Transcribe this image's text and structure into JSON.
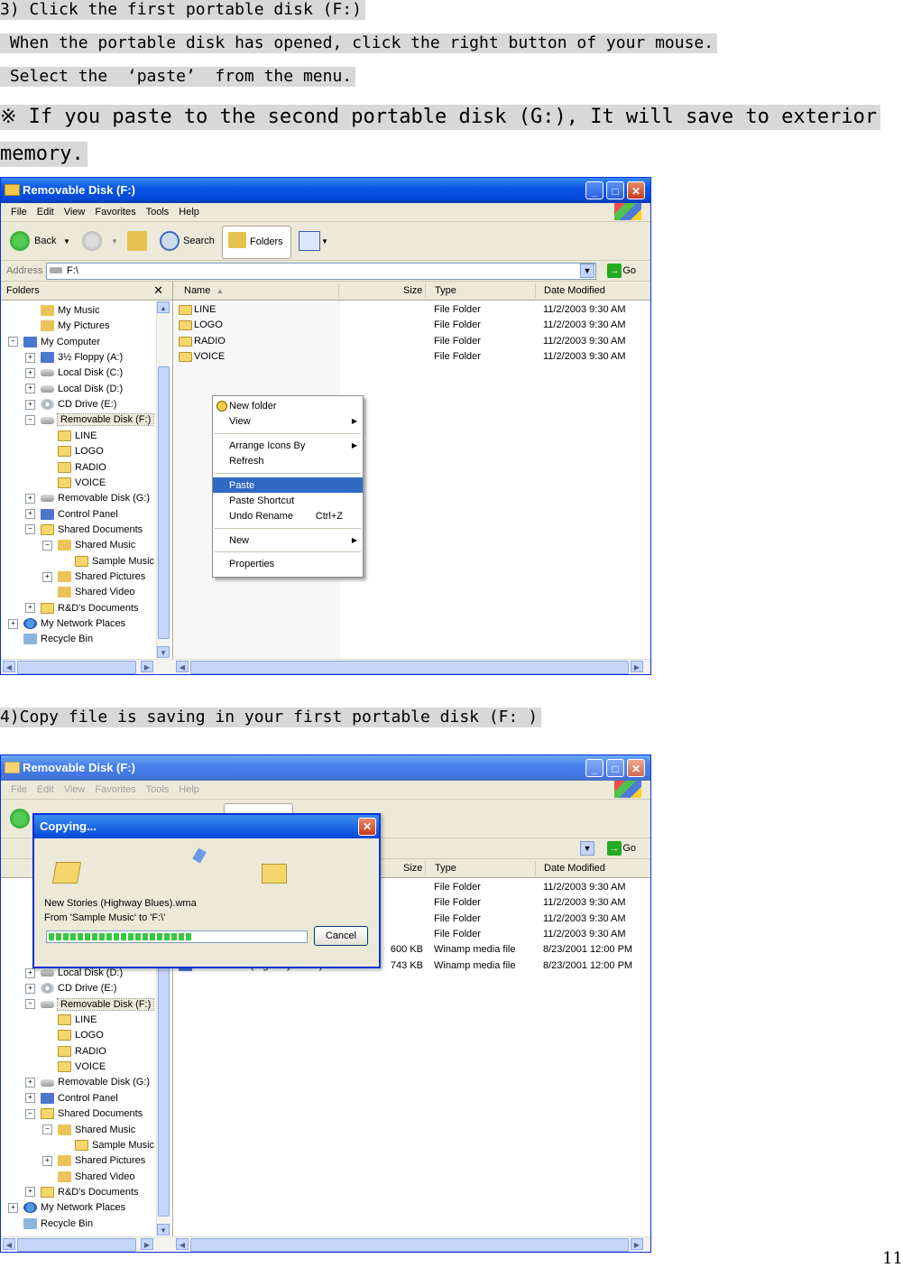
{
  "instructions": {
    "line1": "3) Click the first portable disk (F:)",
    "line2": " When the portable disk has opened, click the right button of your mouse.",
    "line3": " Select the  ‘paste’  from the menu.",
    "note_line1": "※ If you paste to the second portable disk (G:), It will save to exterior",
    "note_line2": "memory.",
    "step4": "4)Copy file is saving in your first portable disk (F: )"
  },
  "page_number": "11",
  "window": {
    "title": "Removable Disk (F:)",
    "menu": [
      "File",
      "Edit",
      "View",
      "Favorites",
      "Tools",
      "Help"
    ],
    "toolbar": {
      "back": "Back",
      "search": "Search",
      "folders": "Folders"
    },
    "address_label": "Address",
    "address_value": "F:\\",
    "go": "Go",
    "folders_header": "Folders",
    "columns": {
      "name": "Name",
      "size": "Size",
      "type": "Type",
      "date": "Date Modified"
    }
  },
  "tree1": [
    {
      "label": "My Music",
      "indent": 2,
      "icon": "music-folder-icon"
    },
    {
      "label": "My Pictures",
      "indent": 2,
      "icon": "pictures-folder-icon"
    },
    {
      "label": "My Computer",
      "indent": 1,
      "pm": "-",
      "icon": "computer-icon"
    },
    {
      "label": "3½ Floppy (A:)",
      "indent": 2,
      "pm": "+",
      "icon": "floppy-icon"
    },
    {
      "label": "Local Disk (C:)",
      "indent": 2,
      "pm": "+",
      "icon": "drive-icon"
    },
    {
      "label": "Local Disk (D:)",
      "indent": 2,
      "pm": "+",
      "icon": "drive-icon"
    },
    {
      "label": "CD Drive (E:)",
      "indent": 2,
      "pm": "+",
      "icon": "cd-icon"
    },
    {
      "label": "Removable Disk (F:)",
      "indent": 2,
      "pm": "-",
      "icon": "drive-icon",
      "sel": true
    },
    {
      "label": "LINE",
      "indent": 3,
      "icon": "folder-icon"
    },
    {
      "label": "LOGO",
      "indent": 3,
      "icon": "folder-icon"
    },
    {
      "label": "RADIO",
      "indent": 3,
      "icon": "folder-icon"
    },
    {
      "label": "VOICE",
      "indent": 3,
      "icon": "folder-icon"
    },
    {
      "label": "Removable Disk (G:)",
      "indent": 2,
      "pm": "+",
      "icon": "drive-icon"
    },
    {
      "label": "Control Panel",
      "indent": 2,
      "pm": "+",
      "icon": "control-panel-icon"
    },
    {
      "label": "Shared Documents",
      "indent": 2,
      "pm": "-",
      "icon": "folder-icon"
    },
    {
      "label": "Shared Music",
      "indent": 3,
      "pm": "-",
      "icon": "music-folder-icon"
    },
    {
      "label": "Sample Music",
      "indent": 4,
      "icon": "folder-icon"
    },
    {
      "label": "Shared Pictures",
      "indent": 3,
      "pm": "+",
      "icon": "pictures-folder-icon"
    },
    {
      "label": "Shared Video",
      "indent": 3,
      "icon": "video-folder-icon"
    },
    {
      "label": "R&D's Documents",
      "indent": 2,
      "pm": "+",
      "icon": "folder-icon"
    },
    {
      "label": "My Network Places",
      "indent": 1,
      "pm": "+",
      "icon": "network-icon"
    },
    {
      "label": "Recycle Bin",
      "indent": 1,
      "icon": "recycle-bin-icon"
    }
  ],
  "tree2": [
    {
      "label": "Local Disk (D:)",
      "indent": 2,
      "pm": "+",
      "icon": "drive-icon"
    },
    {
      "label": "CD Drive (E:)",
      "indent": 2,
      "pm": "+",
      "icon": "cd-icon"
    },
    {
      "label": "Removable Disk (F:)",
      "indent": 2,
      "pm": "-",
      "icon": "drive-icon",
      "sel": true
    },
    {
      "label": "LINE",
      "indent": 3,
      "icon": "folder-icon"
    },
    {
      "label": "LOGO",
      "indent": 3,
      "icon": "folder-icon"
    },
    {
      "label": "RADIO",
      "indent": 3,
      "icon": "folder-icon"
    },
    {
      "label": "VOICE",
      "indent": 3,
      "icon": "folder-icon"
    },
    {
      "label": "Removable Disk (G:)",
      "indent": 2,
      "pm": "+",
      "icon": "drive-icon"
    },
    {
      "label": "Control Panel",
      "indent": 2,
      "pm": "+",
      "icon": "control-panel-icon"
    },
    {
      "label": "Shared Documents",
      "indent": 2,
      "pm": "-",
      "icon": "folder-icon"
    },
    {
      "label": "Shared Music",
      "indent": 3,
      "pm": "-",
      "icon": "music-folder-icon"
    },
    {
      "label": "Sample Music",
      "indent": 4,
      "icon": "folder-icon"
    },
    {
      "label": "Shared Pictures",
      "indent": 3,
      "pm": "+",
      "icon": "pictures-folder-icon"
    },
    {
      "label": "Shared Video",
      "indent": 3,
      "icon": "video-folder-icon"
    },
    {
      "label": "R&D's Documents",
      "indent": 2,
      "pm": "+",
      "icon": "folder-icon"
    },
    {
      "label": "My Network Places",
      "indent": 1,
      "pm": "+",
      "icon": "network-icon"
    },
    {
      "label": "Recycle Bin",
      "indent": 1,
      "icon": "recycle-bin-icon"
    }
  ],
  "files1": [
    {
      "name": "LINE",
      "size": "",
      "type": "File Folder",
      "date": "11/2/2003 9:30 AM"
    },
    {
      "name": "LOGO",
      "size": "",
      "type": "File Folder",
      "date": "11/2/2003 9:30 AM"
    },
    {
      "name": "RADIO",
      "size": "",
      "type": "File Folder",
      "date": "11/2/2003 9:30 AM"
    },
    {
      "name": "VOICE",
      "size": "",
      "type": "File Folder",
      "date": "11/2/2003 9:30 AM"
    }
  ],
  "files2": [
    {
      "name": "",
      "size": "",
      "type": "File Folder",
      "date": "11/2/2003 9:30 AM"
    },
    {
      "name": "",
      "size": "",
      "type": "File Folder",
      "date": "11/2/2003 9:30 AM"
    },
    {
      "name": "",
      "size": "",
      "type": "File Folder",
      "date": "11/2/2003 9:30 AM"
    },
    {
      "name": "",
      "size": "",
      "type": "File Folder",
      "date": "11/2/2003 9:30 AM"
    },
    {
      "name": "",
      "size": "600 KB",
      "type": "Winamp media file",
      "date": "8/23/2001 12:00 PM"
    },
    {
      "name": "New Stories (Highway Blues).wma",
      "size": "743 KB",
      "type": "Winamp media file",
      "date": "8/23/2001 12:00 PM"
    }
  ],
  "context_menu": [
    {
      "label": "New folder",
      "icon": true
    },
    {
      "label": "View",
      "arrow": true
    },
    {
      "sep": true
    },
    {
      "label": "Arrange Icons By",
      "arrow": true
    },
    {
      "label": "Refresh"
    },
    {
      "sep": true
    },
    {
      "label": "Paste",
      "highlight": true
    },
    {
      "label": "Paste Shortcut"
    },
    {
      "label": "Undo Rename",
      "shortcut": "Ctrl+Z"
    },
    {
      "sep": true
    },
    {
      "label": "New",
      "arrow": true
    },
    {
      "sep": true
    },
    {
      "label": "Properties"
    }
  ],
  "copy_dialog": {
    "title": "Copying...",
    "file": "New Stories (Highway Blues).wma",
    "from_to": "From 'Sample Music' to 'F:\\'",
    "cancel": "Cancel",
    "progress": 0.55
  },
  "colors": {
    "xp_blue": "#0a55e4",
    "menu_highlight": "#316ac5",
    "progress_green": "#37c93f"
  }
}
